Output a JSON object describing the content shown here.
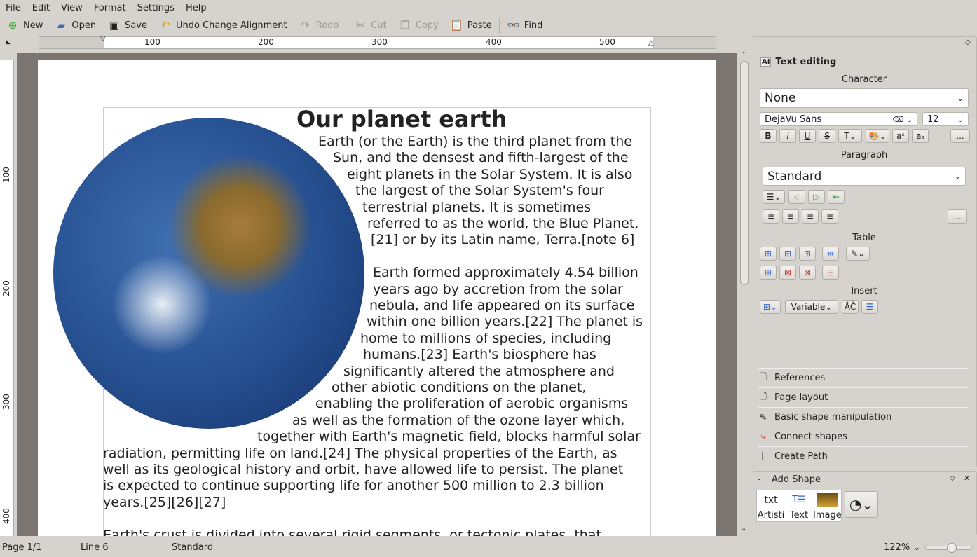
{
  "menu": [
    "File",
    "Edit",
    "View",
    "Format",
    "Settings",
    "Help"
  ],
  "toolbar": {
    "new": "New",
    "open": "Open",
    "save": "Save",
    "undo": "Undo Change Alignment",
    "redo": "Redo",
    "cut": "Cut",
    "copy": "Copy",
    "paste": "Paste",
    "find": "Find"
  },
  "ruler": {
    "top": [
      "100",
      "200",
      "300",
      "400",
      "500"
    ],
    "left": [
      "100",
      "200",
      "300",
      "400"
    ]
  },
  "document": {
    "title": "Our planet earth",
    "lines": [
      "Earth (or the Earth) is the third planet from the",
      "Sun, and the densest and fifth-largest of the",
      "eight planets in the Solar System. It is also",
      "the largest of the Solar System's four",
      "terrestrial planets. It is sometimes",
      "referred to as the world, the Blue Planet,",
      "[21] or by its Latin name, Terra.[note 6]",
      "",
      "Earth formed approximately 4.54 billion",
      "years ago by accretion from the solar",
      "nebula, and life appeared on its surface",
      "within one billion years.[22] The planet is",
      "home to millions of species, including",
      "humans.[23] Earth's biosphere has",
      "significantly altered the atmosphere and",
      "other abiotic conditions on the planet,",
      "enabling the proliferation of aerobic organisms",
      "as well as the formation of the ozone layer which,",
      "together with Earth's magnetic field, blocks harmful solar",
      "radiation, permitting life on land.[24] The physical properties of the Earth, as",
      "well as its geological history and orbit, have allowed life to persist. The planet",
      "is expected to continue supporting life for another 500 million to 2.3 billion",
      "years.[25][26][27]",
      "",
      "Earth's crust is divided into several rigid segments, or tectonic plates, that"
    ]
  },
  "panel": {
    "title": "Text editing",
    "character": "Character",
    "char_style": "None",
    "font": "DejaVu Sans",
    "size": "12",
    "more": "...",
    "paragraph": "Paragraph",
    "para_style": "Standard",
    "table": "Table",
    "insert": "Insert",
    "variable": "Variable",
    "docks": [
      "References",
      "Page layout",
      "Basic shape manipulation",
      "Connect shapes",
      "Create Path"
    ]
  },
  "add_shape": {
    "title": "Add Shape",
    "items": [
      "Artisti",
      "Text",
      "Image"
    ]
  },
  "status": {
    "page": "Page 1/1",
    "line": "Line 6",
    "style": "Standard",
    "zoom": "122%",
    "zoom_slider": 0.55
  }
}
